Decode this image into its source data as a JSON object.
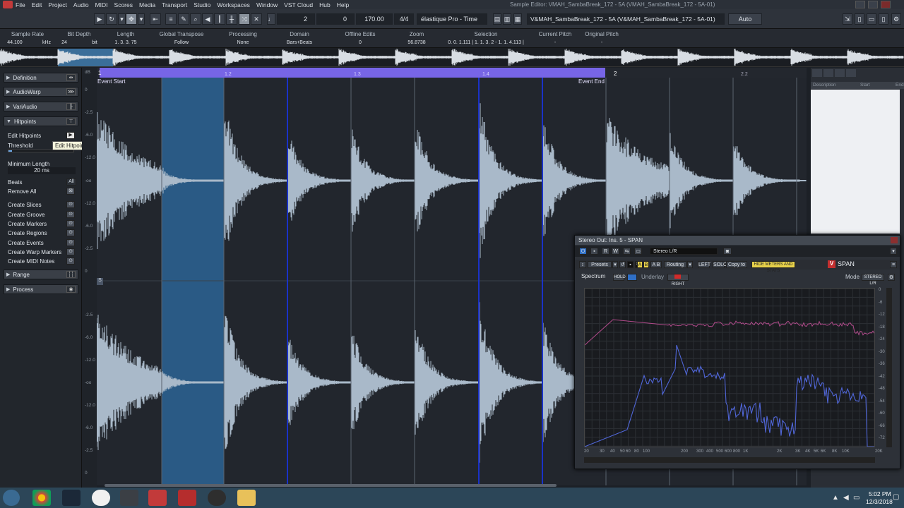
{
  "menubar": {
    "items": [
      "File",
      "Edit",
      "Project",
      "Audio",
      "MIDI",
      "Scores",
      "Media",
      "Transport",
      "Studio",
      "Workspaces",
      "Window",
      "VST Cloud",
      "Hub",
      "Help"
    ],
    "window_title": "Sample Editor: VMAH_SambaBreak_172 - 5A (VMAH_SambaBreak_172 - 5A-01)"
  },
  "toolbar": {
    "bar_value": "2",
    "beat_value": "0",
    "tempo": "170.00",
    "signature": "4/4",
    "algorithm": "élastique Pro - Time",
    "clip_name": "V&MAH_SambaBreak_172 - 5A",
    "clip_event": "V&MAH_SambaBreak_172 - 5A (V&MAH_SambaBreak_172 - 5A-01)",
    "auto": "Auto"
  },
  "infoline": [
    {
      "header": "Sample Rate",
      "value": "44.100",
      "unit": "kHz"
    },
    {
      "header": "Bit Depth",
      "value": "24",
      "unit": "bit"
    },
    {
      "header": "Length",
      "value": "1. 3. 3. 75"
    },
    {
      "header": "Global Transpose",
      "value": "Follow"
    },
    {
      "header": "Processing",
      "value": "None"
    },
    {
      "header": "Domain",
      "value": "Bars+Beats"
    },
    {
      "header": "Offline Edits",
      "value": "0"
    },
    {
      "header": "Zoom",
      "value": "56.8738"
    },
    {
      "header": "Selection",
      "value": "0. 0. 1.111 | 1. 1. 3. 2 - 1. 1. 4.113 |"
    },
    {
      "header": "Current Pitch",
      "value": "-"
    },
    {
      "header": "Original Pitch",
      "value": "-"
    }
  ],
  "inspector": {
    "sections": [
      "Definition",
      "AudioWarp",
      "VariAudio",
      "Hitpoints",
      "Range",
      "Process"
    ],
    "edit_hitpoints": "Edit Hitpoints",
    "threshold": "Threshold",
    "min_length_label": "Minimum Length",
    "min_length_value": "20 ms",
    "beats": "Beats",
    "beats_value": "All",
    "remove_all": "Remove All",
    "actions": [
      "Create Slices",
      "Create Groove",
      "Create Markers",
      "Create Regions",
      "Create Events",
      "Create Warp Markers",
      "Create MIDI Notes"
    ],
    "tooltip": "Edit Hitpoints"
  },
  "ruler": {
    "labels": [
      "1",
      "1.2",
      "1.3",
      "1.4",
      "2",
      "2.2"
    ],
    "event_start": "Event Start",
    "event_end": "Event End"
  },
  "db_scale": [
    "dB",
    "0",
    "-2.5",
    "-6.0",
    "-12.0",
    "-oo",
    "-12.0",
    "-6.0",
    "-2.5",
    "0",
    "-2.5",
    "-6.0",
    "-12.0",
    "-oo",
    "-12.0",
    "-6.0",
    "-2.5",
    "0"
  ],
  "rightpanel": {
    "headers": [
      "Description",
      "Start",
      "End"
    ]
  },
  "span": {
    "title": "Stereo Out: Ins. 5 - SPAN",
    "channel": "Stereo L/R",
    "presets": "Presets",
    "a": "A",
    "b": "B",
    "ab": "A B",
    "routing": "Routing",
    "left": "LEFT",
    "solo": "SOLO",
    "copy": "Copy to",
    "hide": "HIDE METERS AND STATS",
    "brand": "SPAN",
    "spectrum": "Spectrum",
    "hold": "HOLD",
    "underlay": "Underlay",
    "right": "RIGHT",
    "mode_label": "Mode",
    "mode_value": "STEREO L/R",
    "freq_labels": [
      "20",
      "30",
      "40",
      "50",
      "60",
      "80",
      "100",
      "200",
      "300",
      "400",
      "500",
      "600",
      "800",
      "1K",
      "2K",
      "3K",
      "4K",
      "5K",
      "6K",
      "8K",
      "10K",
      "20K"
    ],
    "db_labels": [
      "0",
      "-6",
      "-12",
      "-18",
      "-24",
      "-30",
      "-36",
      "-42",
      "-48",
      "-54",
      "-60",
      "-66",
      "-72"
    ]
  },
  "taskbar": {
    "time": "5:02 PM",
    "date": "12/3/2018"
  },
  "colors": {
    "accent": "#7765e6",
    "wave": "#a9b9c9",
    "selection": "#2a5a85",
    "hitpoint": "#1a32c8",
    "span_red": "#d12b2b"
  }
}
